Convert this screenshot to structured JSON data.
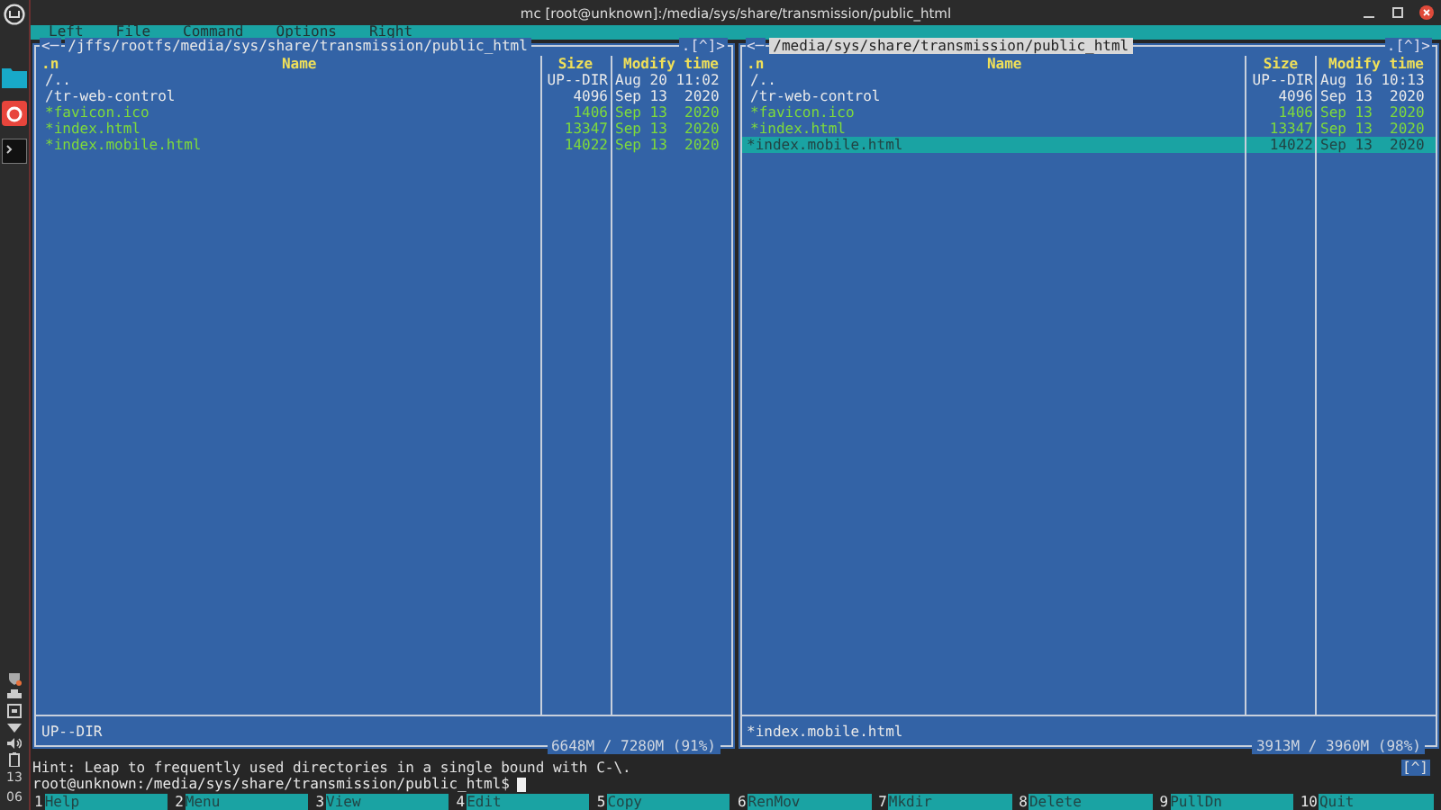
{
  "window": {
    "title": "mc [root@unknown]:/media/sys/share/transmission/public_html"
  },
  "taskbar": {
    "clock_hour": "13",
    "clock_minute": "06"
  },
  "menu": [
    "Left",
    "File",
    "Command",
    "Options",
    "Right"
  ],
  "panels": [
    {
      "active": false,
      "corner_left": "<─",
      "path": "/jffs/rootfs/media/sys/share/transmission/public_html",
      "corner_right": ".[^]>",
      "columns": [
        ".n",
        "Name",
        "Size",
        "Modify time"
      ],
      "rows": [
        {
          "kind": "dir",
          "name": "/..",
          "size": "UP--DIR",
          "modified": "Aug 20 11:02",
          "selected": false
        },
        {
          "kind": "dir",
          "name": "/tr-web-control",
          "size": "4096",
          "modified": "Sep 13  2020",
          "selected": false
        },
        {
          "kind": "exec",
          "name": "*favicon.ico",
          "size": "1406",
          "modified": "Sep 13  2020",
          "selected": false
        },
        {
          "kind": "exec",
          "name": "*index.html",
          "size": "13347",
          "modified": "Sep 13  2020",
          "selected": false
        },
        {
          "kind": "exec",
          "name": "*index.mobile.html",
          "size": "14022",
          "modified": "Sep 13  2020",
          "selected": false
        }
      ],
      "mini_status": "UP--DIR",
      "free_space": "6648M / 7280M (91%)"
    },
    {
      "active": true,
      "corner_left": "<─",
      "path": "/media/sys/share/transmission/public_html",
      "corner_right": ".[^]>",
      "columns": [
        ".n",
        "Name",
        "Size",
        "Modify time"
      ],
      "rows": [
        {
          "kind": "dir",
          "name": "/..",
          "size": "UP--DIR",
          "modified": "Aug 16 10:13",
          "selected": false
        },
        {
          "kind": "dir",
          "name": "/tr-web-control",
          "size": "4096",
          "modified": "Sep 13  2020",
          "selected": false
        },
        {
          "kind": "exec",
          "name": "*favicon.ico",
          "size": "1406",
          "modified": "Sep 13  2020",
          "selected": false
        },
        {
          "kind": "exec",
          "name": "*index.html",
          "size": "13347",
          "modified": "Sep 13  2020",
          "selected": false
        },
        {
          "kind": "exec",
          "name": "*index.mobile.html",
          "size": "14022",
          "modified": "Sep 13  2020",
          "selected": true
        }
      ],
      "mini_status": "*index.mobile.html",
      "free_space": "3913M / 3960M (98%)"
    }
  ],
  "hint": "Hint: Leap to frequently used directories in a single bound with C-\\.",
  "prompt": "root@unknown:/media/sys/share/transmission/public_html$",
  "history_button": "[^]",
  "function_keys": [
    {
      "number": "1",
      "label": "Help"
    },
    {
      "number": "2",
      "label": "Menu"
    },
    {
      "number": "3",
      "label": "View"
    },
    {
      "number": "4",
      "label": "Edit"
    },
    {
      "number": "5",
      "label": "Copy"
    },
    {
      "number": "6",
      "label": "RenMov"
    },
    {
      "number": "7",
      "label": "Mkdir"
    },
    {
      "number": "8",
      "label": "Delete"
    },
    {
      "number": "9",
      "label": "PullDn"
    },
    {
      "number": "10",
      "label": "Quit"
    }
  ]
}
